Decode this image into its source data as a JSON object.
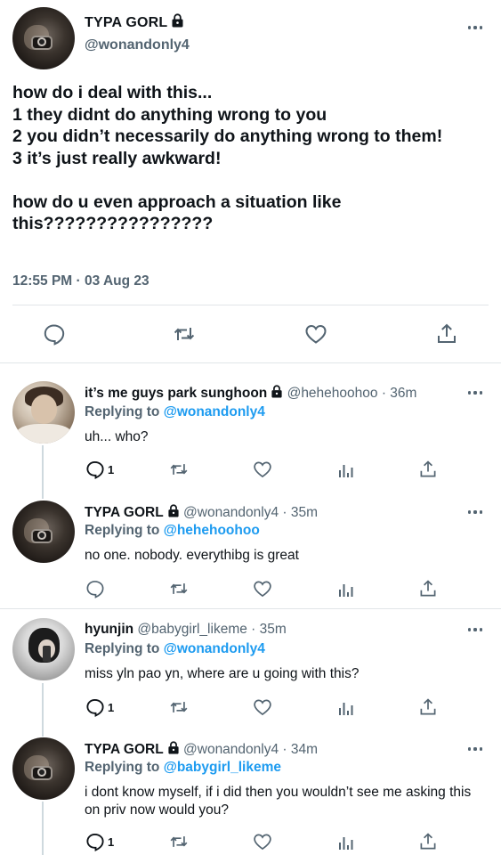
{
  "main_tweet": {
    "display_name": "TYPA GORL",
    "handle": "@wonandonly4",
    "text": "how do i deal with this...\n1 they didnt do anything wrong to you\n2 you didn’t necessarily do anything wrong to them!\n3 it’s just really awkward!\n\nhow do u even approach a situation like this????????????????",
    "timestamp": "12:55 PM · 03 Aug 23"
  },
  "replies": [
    {
      "display_name": "it’s me guys park sunghoon",
      "handle": "@hehehoohoo",
      "time": "· 36m",
      "replying_prefix": "Replying to",
      "replying_to": "@wonandonly4",
      "text": "uh... who?",
      "reply_count": "1",
      "locked": true
    },
    {
      "display_name": "TYPA GORL",
      "handle": "@wonandonly4",
      "time": "· 35m",
      "replying_prefix": "Replying to",
      "replying_to": "@hehehoohoo",
      "text": "no one. nobody. everythibg is great",
      "reply_count": "",
      "locked": true
    },
    {
      "display_name": "hyunjin",
      "handle": "@babygirl_likeme",
      "time": "· 35m",
      "replying_prefix": "Replying to",
      "replying_to": "@wonandonly4",
      "text": "miss yln pao yn, where are u going with this?",
      "reply_count": "1",
      "locked": false
    },
    {
      "display_name": "TYPA GORL",
      "handle": "@wonandonly4",
      "time": "· 34m",
      "replying_prefix": "Replying to",
      "replying_to": "@babygirl_likeme",
      "text": "i dont know myself, if i did then you wouldn’t see me asking this on priv now would you?",
      "reply_count": "1",
      "locked": true
    }
  ],
  "icons": {
    "reply": "reply-icon",
    "retweet": "retweet-icon",
    "like": "heart-icon",
    "share": "share-icon",
    "analytics": "analytics-icon",
    "lock": "lock-icon",
    "more": "more-icon"
  },
  "colors": {
    "text": "#0f1419",
    "secondary": "#536471",
    "accent": "#1d9bf0",
    "divider": "#e1e5e8"
  }
}
